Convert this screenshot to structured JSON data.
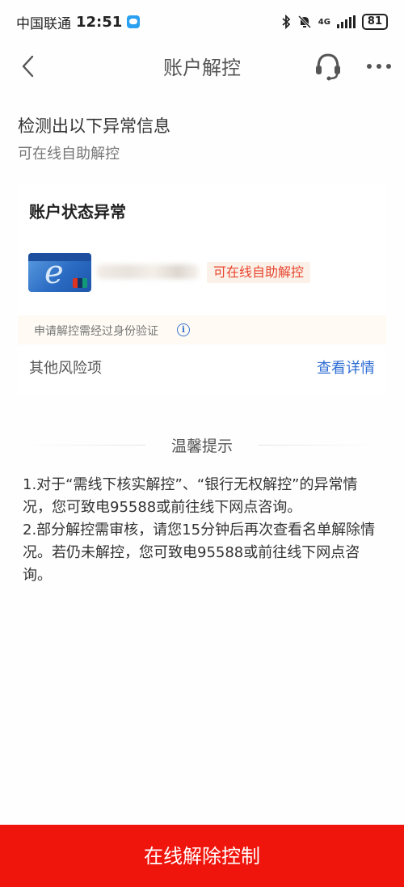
{
  "status_bar": {
    "carrier": "中国联通",
    "time": "12:51",
    "network": "4G",
    "battery": "81"
  },
  "nav": {
    "title": "账户解控",
    "more_glyph": "•••"
  },
  "header": {
    "detect_title": "检测出以下异常信息",
    "detect_sub": "可在线自助解控"
  },
  "card": {
    "title": "账户状态异常",
    "status_tag": "可在线自助解控",
    "verify_note": "申请解控需经过身份验证",
    "info_glyph": "i",
    "other_risk": "其他风险项",
    "view_detail": "查看详情"
  },
  "tips": {
    "title": "温馨提示",
    "items": [
      "1.对于“需线下核实解控”、“银行无权解控”的异常情况，您可致电95588或前往线下网点咨询。",
      "2.部分解控需审核，请您15分钟后再次查看名单解除情况。若仍未解控，您可致电95588或前往线下网点咨询。"
    ]
  },
  "bottom_button": {
    "label": "在线解除控制"
  },
  "colors": {
    "primary_red": "#f0150c",
    "status_red": "#e8452e",
    "link_blue": "#2f6ed4"
  },
  "icons": {
    "back": "chevron-left-icon",
    "service": "headset-icon",
    "more": "more-dots-icon",
    "info": "info-icon"
  }
}
